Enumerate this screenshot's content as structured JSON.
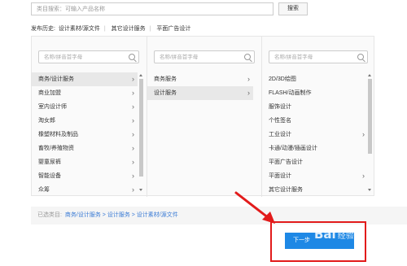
{
  "search": {
    "placeholder": "类目搜索：可输入产品名称",
    "button_label": "搜索"
  },
  "history": {
    "label": "发布历史:",
    "items": [
      "设计素材/源文件",
      "其它设计服务",
      "平面广告设计"
    ],
    "separator": "|"
  },
  "columns": [
    {
      "filter_placeholder": "名称/拼音首字母",
      "items": [
        {
          "label": "商务/设计服务",
          "has_children": true,
          "selected": true
        },
        {
          "label": "商业加盟",
          "has_children": true,
          "selected": false
        },
        {
          "label": "室内设计师",
          "has_children": true,
          "selected": false
        },
        {
          "label": "淘女郎",
          "has_children": true,
          "selected": false
        },
        {
          "label": "橡塑材料及制品",
          "has_children": true,
          "selected": false
        },
        {
          "label": "畜牧/养殖物资",
          "has_children": true,
          "selected": false
        },
        {
          "label": "婴童尿裤",
          "has_children": true,
          "selected": false
        },
        {
          "label": "智能设备",
          "has_children": true,
          "selected": false
        },
        {
          "label": "众筹",
          "has_children": true,
          "selected": false
        }
      ]
    },
    {
      "filter_placeholder": "名称/拼音首字母",
      "items": [
        {
          "label": "商务服务",
          "has_children": true,
          "selected": false
        },
        {
          "label": "设计服务",
          "has_children": true,
          "selected": true
        }
      ]
    },
    {
      "filter_placeholder": "名称/拼音首字母",
      "items": [
        {
          "label": "2D/3D绘图",
          "has_children": false,
          "selected": false
        },
        {
          "label": "FLASH/动画制作",
          "has_children": false,
          "selected": false
        },
        {
          "label": "服饰设计",
          "has_children": false,
          "selected": false
        },
        {
          "label": "个性签名",
          "has_children": false,
          "selected": false
        },
        {
          "label": "工业设计",
          "has_children": true,
          "selected": false
        },
        {
          "label": "卡通/动漫/插画设计",
          "has_children": false,
          "selected": false
        },
        {
          "label": "平面广告设计",
          "has_children": false,
          "selected": false
        },
        {
          "label": "平面设计",
          "has_children": true,
          "selected": false
        },
        {
          "label": "其它设计服务",
          "has_children": false,
          "selected": false
        }
      ]
    }
  ],
  "selected_path": {
    "label": "已选类目:",
    "value": "商务/设计服务 > 设计服务 > 设计素材/源文件"
  },
  "next_button": {
    "label": "下一步"
  },
  "watermark": {
    "text": "Bai",
    "sub": "经验"
  },
  "colors": {
    "accent": "#1e88e5",
    "link": "#3a7bd5",
    "annotation": "#e21b1b"
  },
  "icons": [
    "search-icon",
    "chevron-right-icon",
    "scroll-up-icon",
    "scroll-down-icon"
  ]
}
